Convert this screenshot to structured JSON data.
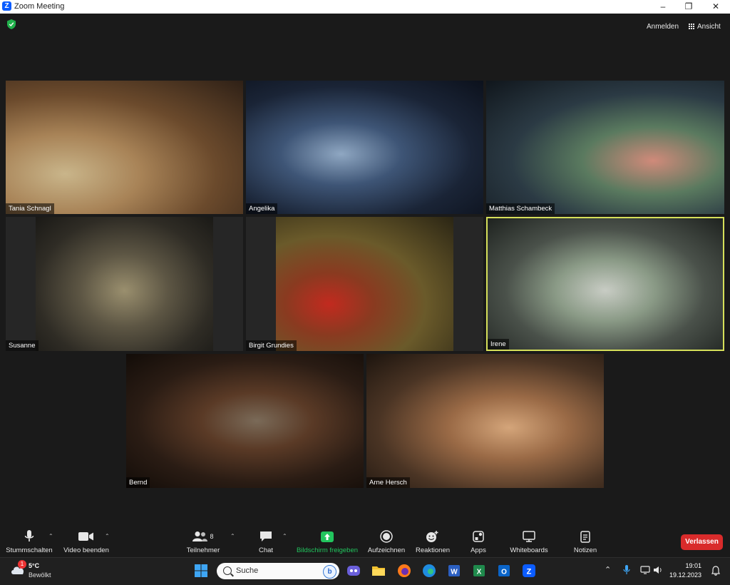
{
  "window": {
    "title": "Zoom Meeting",
    "app_icon_letter": "Z"
  },
  "header": {
    "signin_label": "Anmelden",
    "view_label": "Ansicht",
    "security_icon": "shield-check-icon"
  },
  "participants": [
    {
      "name": "Tania Schnagl"
    },
    {
      "name": "Angelika"
    },
    {
      "name": "Matthias Schambeck"
    },
    {
      "name": "Susanne"
    },
    {
      "name": "Birgit Grundies"
    },
    {
      "name": "Irene"
    },
    {
      "name": "Bernd"
    },
    {
      "name": "Arne Hersch"
    }
  ],
  "toolbar": {
    "mute_label": "Stummschalten",
    "video_label": "Video beenden",
    "participants_label": "Teilnehmer",
    "participants_count": "8",
    "chat_label": "Chat",
    "share_label": "Bildschirm freigeben",
    "record_label": "Aufzeichnen",
    "reactions_label": "Reaktionen",
    "apps_label": "Apps",
    "whiteboards_label": "Whiteboards",
    "notes_label": "Notizen",
    "leave_label": "Verlassen"
  },
  "taskbar": {
    "weather_temp": "5°C",
    "weather_condition": "Bewölkt",
    "weather_badge": "1",
    "search_placeholder": "Suche",
    "time": "19:01",
    "date": "19.12.2023"
  },
  "colors": {
    "active_speaker_border": "#d6e05a",
    "share_green": "#22c55e",
    "leave_red": "#d92b2b",
    "zoom_blue": "#0b5cff"
  }
}
